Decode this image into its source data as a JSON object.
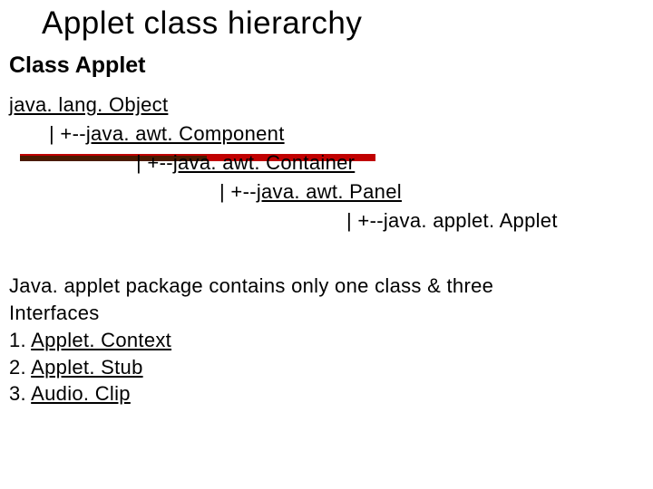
{
  "title": "Applet class hierarchy",
  "subtitle": "Class Applet",
  "hierarchy": {
    "root": "java. lang. Object",
    "l1_prefix": "| +--",
    "l1": "java. awt. Component",
    "l2_prefix": "| +--",
    "l2": "java. awt. Container",
    "l3_prefix": "| +--",
    "l3": "java. awt. Panel",
    "l4_prefix": "| +--",
    "l4": "java. applet. Applet"
  },
  "paragraph": {
    "line1": "Java. applet package contains only one class & three",
    "line2": "Interfaces",
    "i1_num": "1. ",
    "i1": "Applet. Context",
    "i2_num": "2. ",
    "i2": "Applet. Stub",
    "i3_num": "3. ",
    "i3": "Audio. Clip"
  }
}
